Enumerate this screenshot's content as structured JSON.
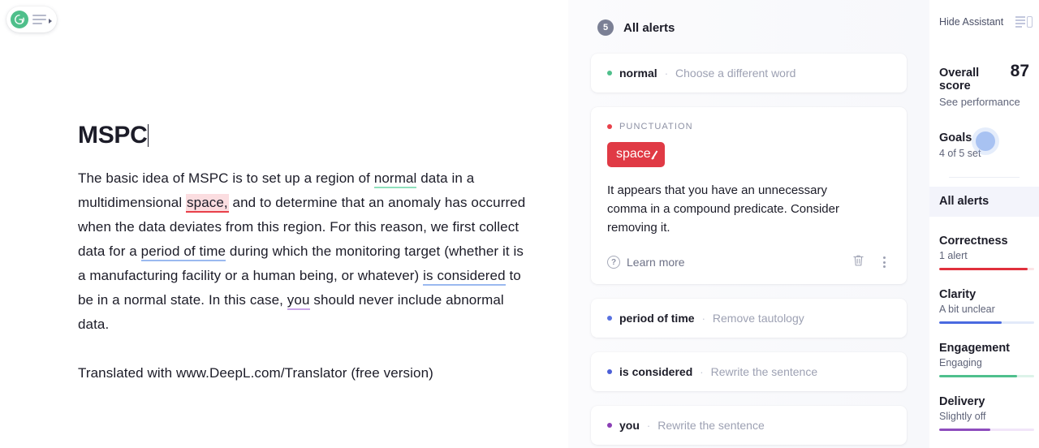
{
  "logo": {
    "letter": "G",
    "brand_color": "#4fbf8b"
  },
  "document": {
    "title": "MSPC",
    "paragraphs": [
      {
        "runs": [
          {
            "text": "The basic idea of MSPC is to set up a region of ",
            "mark": "none"
          },
          {
            "text": "normal",
            "mark": "green"
          },
          {
            "text": " data in a multidimensional ",
            "mark": "none"
          },
          {
            "text": "space,",
            "mark": "red-highlight"
          },
          {
            "text": " and to determine that an anomaly has occurred when the data deviates from this region. For this reason, we first collect data for a ",
            "mark": "none"
          },
          {
            "text": "period of time",
            "mark": "blue"
          },
          {
            "text": " during which the monitoring target (whether it is a manufacturing facility or a human being, or whatever) ",
            "mark": "none"
          },
          {
            "text": "is considered",
            "mark": "blue"
          },
          {
            "text": " to be in a normal state. In this case, ",
            "mark": "none"
          },
          {
            "text": "you",
            "mark": "purple"
          },
          {
            "text": " should never include abnormal data.",
            "mark": "none"
          }
        ]
      },
      {
        "runs": [
          {
            "text": "Translated with www.DeepL.com/Translator (free version)",
            "mark": "none"
          }
        ]
      }
    ]
  },
  "alerts_panel": {
    "count": "5",
    "title": "All alerts",
    "cards": [
      {
        "state": "collapsed",
        "dot_color": "#4fbf8b",
        "term": "normal",
        "separator": "·",
        "action": "Choose a different word"
      },
      {
        "state": "expanded",
        "dot_color": "#e8404a",
        "category": "PUNCTUATION",
        "chip_text": "space",
        "chip_strike": ",",
        "chip_color": "#e03a45",
        "description": "It appears that you have an unnecessary comma in a compound predicate. Consider removing it.",
        "learn_more": "Learn more",
        "help_glyph": "?"
      },
      {
        "state": "collapsed",
        "dot_color": "#5871e0",
        "term": "period of time",
        "separator": "·",
        "action": "Remove tautology"
      },
      {
        "state": "collapsed",
        "dot_color": "#4c5fd7",
        "term": "is considered",
        "separator": "·",
        "action": "Rewrite the sentence"
      },
      {
        "state": "collapsed",
        "dot_color": "#8b3fb5",
        "term": "you",
        "separator": "·",
        "action": "Rewrite the sentence"
      }
    ]
  },
  "sidebar": {
    "hide_assistant": "Hide Assistant",
    "overall_score_label": "Overall score",
    "overall_score_value": "87",
    "see_performance": "See performance",
    "goals_label": "Goals",
    "goals_sub": "4 of 5 set",
    "all_alerts_tab": "All alerts",
    "metrics": [
      {
        "name": "Correctness",
        "sub": "1 alert",
        "percent": 93,
        "color": "#e0303c",
        "track": "#fbe4e6"
      },
      {
        "name": "Clarity",
        "sub": "A bit unclear",
        "percent": 66,
        "color": "#4a6ae0",
        "track": "#e2eaf9"
      },
      {
        "name": "Engagement",
        "sub": "Engaging",
        "percent": 82,
        "color": "#4fc08d",
        "track": "#ddf3e9"
      },
      {
        "name": "Delivery",
        "sub": "Slightly off",
        "percent": 54,
        "color": "#8e4dbd",
        "track": "#f1e5f9"
      }
    ]
  }
}
